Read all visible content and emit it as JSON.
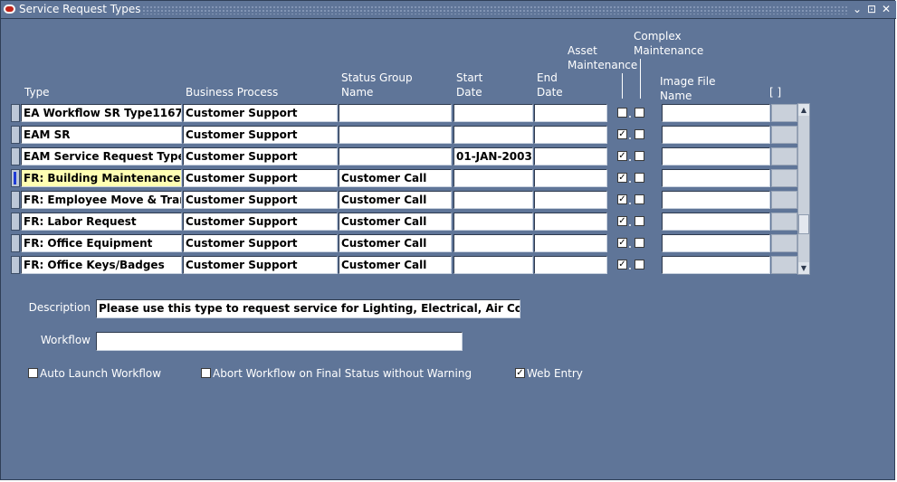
{
  "window": {
    "title": "Service Request Types",
    "minimize": "⌄",
    "maximize": "⊡",
    "close": "✕"
  },
  "columns": {
    "type": "Type",
    "business_process": "Business Process",
    "status_group_l1": "Status Group",
    "status_group_l2": "Name",
    "start_l1": "Start",
    "start_l2": "Date",
    "end_l1": "End",
    "end_l2": "Date",
    "asset_l1": "Asset",
    "asset_l2": "Maintenance",
    "complex_l1": "Complex",
    "complex_l2": "Maintenance",
    "image_l1": "Image File",
    "image_l2": "Name",
    "flex": "[ ]"
  },
  "rows": [
    {
      "type": "EA Workflow SR Type1167",
      "business_process": "Customer Support",
      "status_group": "",
      "start_date": "",
      "end_date": "",
      "asset": false,
      "complex": false,
      "image": ""
    },
    {
      "type": "EAM SR",
      "business_process": "Customer Support",
      "status_group": "",
      "start_date": "",
      "end_date": "",
      "asset": true,
      "complex": false,
      "image": ""
    },
    {
      "type": "EAM Service Request Type",
      "business_process": "Customer Support",
      "status_group": "",
      "start_date": "01-JAN-2003",
      "end_date": "",
      "asset": true,
      "complex": false,
      "image": ""
    },
    {
      "type": "FR: Building Maintenance",
      "business_process": "Customer Support",
      "status_group": "Customer Call",
      "start_date": "",
      "end_date": "",
      "asset": true,
      "complex": false,
      "image": ""
    },
    {
      "type": "FR: Employee Move & Trans",
      "business_process": "Customer Support",
      "status_group": "Customer Call",
      "start_date": "",
      "end_date": "",
      "asset": true,
      "complex": false,
      "image": ""
    },
    {
      "type": "FR: Labor Request",
      "business_process": "Customer Support",
      "status_group": "Customer Call",
      "start_date": "",
      "end_date": "",
      "asset": true,
      "complex": false,
      "image": ""
    },
    {
      "type": "FR: Office Equipment",
      "business_process": "Customer Support",
      "status_group": "Customer Call",
      "start_date": "",
      "end_date": "",
      "asset": true,
      "complex": false,
      "image": ""
    },
    {
      "type": "FR: Office Keys/Badges",
      "business_process": "Customer Support",
      "status_group": "Customer Call",
      "start_date": "",
      "end_date": "",
      "asset": true,
      "complex": false,
      "image": ""
    }
  ],
  "current_row": 3,
  "detail": {
    "description_label": "Description",
    "description_value": "Please use this type to request service for Lighting, Electrical, Air Conditio",
    "workflow_label": "Workflow",
    "workflow_value": ""
  },
  "options": {
    "auto_launch_label": "Auto Launch Workflow",
    "auto_launch": false,
    "abort_label": "Abort Workflow on Final Status without Warning",
    "abort": false,
    "web_entry_label": "Web Entry",
    "web_entry": true
  },
  "scrollbar": {
    "up_arrow": "▲",
    "down_arrow": "▼"
  },
  "colors": {
    "background": "#5f7598",
    "current_cell": "#ffffb3",
    "row_indicator": "#1f3bd6"
  }
}
